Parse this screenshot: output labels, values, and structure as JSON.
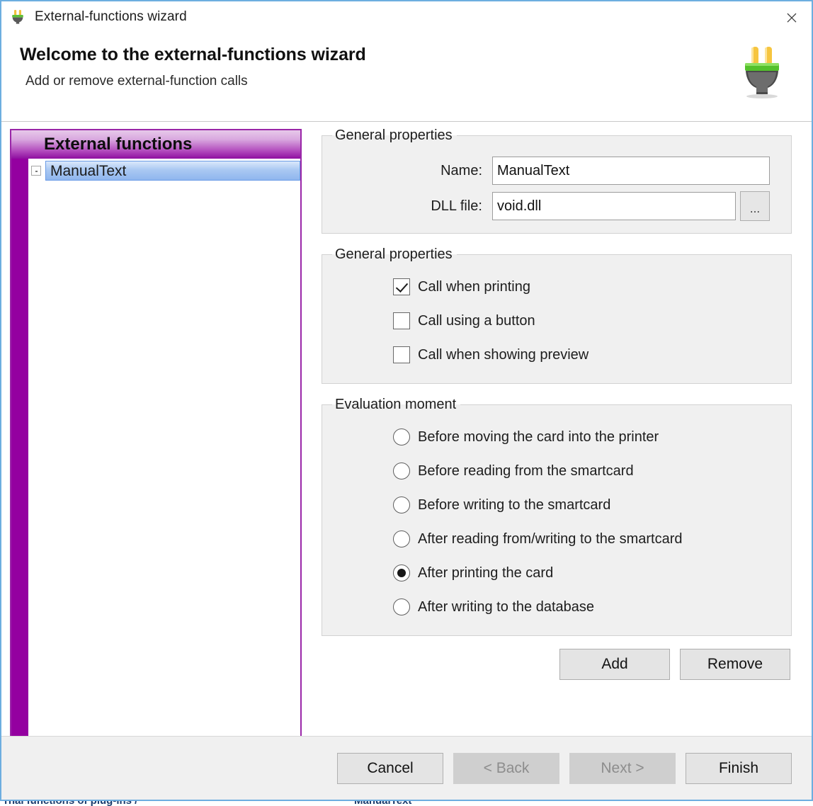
{
  "window": {
    "title": "External-functions wizard",
    "icon": "plug-icon",
    "close_label": "×"
  },
  "header": {
    "title": "Welcome to the external-functions wizard",
    "subtitle": "Add or remove external-function calls",
    "icon": "plug-icon"
  },
  "tree_panel": {
    "header_label": "External functions",
    "items": [
      {
        "label": "ManualText",
        "selected": true,
        "expander": "collapsed"
      }
    ]
  },
  "general_properties": {
    "legend": "General properties",
    "fields": [
      {
        "label": "Name:",
        "value": "ManualText",
        "placeholder": ""
      },
      {
        "label": "DLL file:",
        "value": "void.dll",
        "placeholder": ""
      }
    ],
    "browse_label": "..."
  },
  "call_options": {
    "legend": "General properties",
    "items": [
      {
        "label": "Call when printing",
        "checked": true
      },
      {
        "label": "Call using a button",
        "checked": false
      },
      {
        "label": "Call when showing preview",
        "checked": false
      }
    ]
  },
  "evaluation_moment": {
    "legend": "Evaluation moment",
    "items": [
      {
        "label": "Before moving the card into the printer",
        "selected": false
      },
      {
        "label": "Before reading from the smartcard",
        "selected": false
      },
      {
        "label": "Before writing to the smartcard",
        "selected": false
      },
      {
        "label": "After reading from/writing to the smartcard",
        "selected": false
      },
      {
        "label": "After printing the card",
        "selected": true
      },
      {
        "label": "After writing to the database",
        "selected": false
      }
    ]
  },
  "list_actions": {
    "add_label": "Add",
    "remove_label": "Remove"
  },
  "footer": {
    "cancel_label": "Cancel",
    "back_label": "< Back",
    "next_label": "Next >",
    "finish_label": "Finish",
    "back_disabled": true,
    "next_disabled": true
  },
  "background": {
    "left_text": "rnal functions of plug-ins /",
    "right_text": "ManualText"
  },
  "colors": {
    "panel_purple": "#9400a0",
    "panel_border": "#9a26a8",
    "selection_blue": "#8fb6ee",
    "dialog_border": "#6daee0",
    "surface": "#f0f0f0"
  }
}
